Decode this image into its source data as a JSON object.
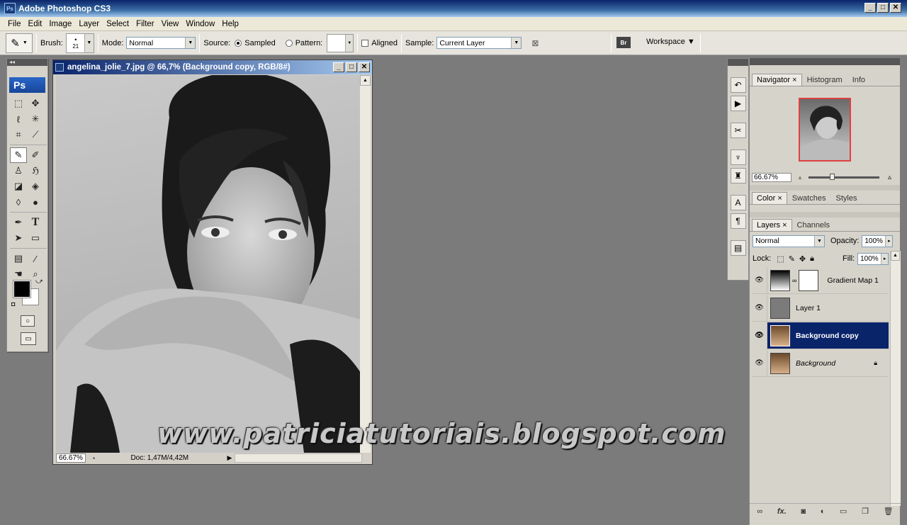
{
  "app": {
    "title": "Adobe Photoshop CS3",
    "icon_label": "Ps"
  },
  "window_buttons": [
    "_",
    "□",
    "✕"
  ],
  "menu": [
    "File",
    "Edit",
    "Image",
    "Layer",
    "Select",
    "Filter",
    "View",
    "Window",
    "Help"
  ],
  "options": {
    "brush_label": "Brush:",
    "brush_size": "21",
    "mode_label": "Mode:",
    "mode_value": "Normal",
    "source_label": "Source:",
    "sampled_label": "Sampled",
    "pattern_label": "Pattern:",
    "aligned_label": "Aligned",
    "sample_label": "Sample:",
    "sample_value": "Current Layer",
    "workspace_label": "Workspace ▼"
  },
  "toolbox": {
    "logo": "Ps"
  },
  "document": {
    "title": "angelina_jolie_7.jpg @ 66,7% (Background copy, RGB/8#)",
    "zoom": "66.67%",
    "doc_info": "Doc: 1,47M/4,42M"
  },
  "navigator": {
    "tabs": [
      "Navigator",
      "Histogram",
      "Info"
    ],
    "zoom": "66.67%"
  },
  "color_panel": {
    "tabs": [
      "Color",
      "Swatches",
      "Styles"
    ]
  },
  "layers_panel": {
    "tabs": [
      "Layers",
      "Channels"
    ],
    "blend_mode": "Normal",
    "opacity_label": "Opacity:",
    "opacity": "100%",
    "lock_label": "Lock:",
    "fill_label": "Fill:",
    "fill": "100%",
    "layers": [
      {
        "name": "Gradient Map 1",
        "selected": false
      },
      {
        "name": "Layer 1",
        "selected": false
      },
      {
        "name": "Background copy",
        "selected": true
      },
      {
        "name": "Background",
        "selected": false,
        "locked": true
      }
    ]
  },
  "watermark": "www.patriciatutoriais.blogspot.com",
  "colors": {
    "workspace": "#7b7b7b",
    "selection": "#0a246a",
    "title_gradient_start": "#0a246a"
  }
}
